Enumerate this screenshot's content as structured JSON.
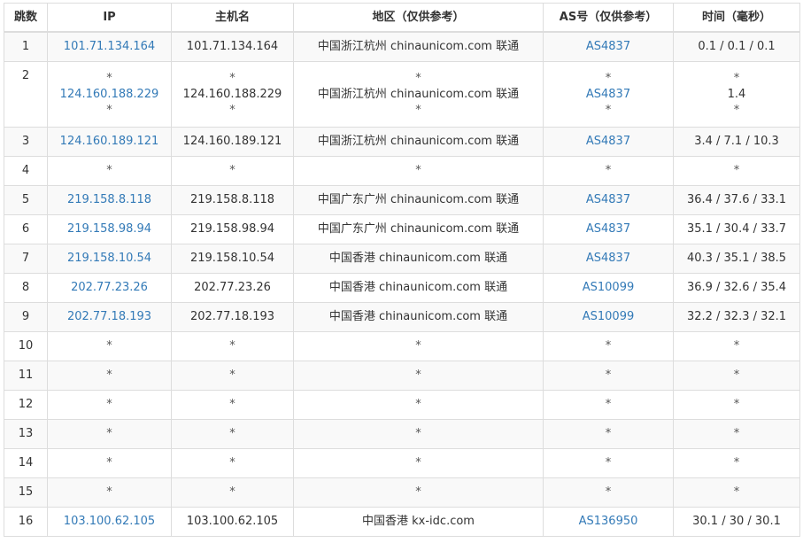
{
  "table": {
    "headers": {
      "hop": "跳数",
      "ip": "IP",
      "hostname": "主机名",
      "location": "地区（仅供参考）",
      "asn": "AS号（仅供参考）",
      "time": "时间（毫秒）"
    },
    "link_color": "#337ab7",
    "rows": [
      {
        "hop": "1",
        "ip": [
          "101.71.134.164"
        ],
        "hostname": [
          "101.71.134.164"
        ],
        "location": [
          "中国浙江杭州 chinaunicom.com 联通"
        ],
        "asn": [
          "AS4837"
        ],
        "time": [
          "0.1 / 0.1 / 0.1"
        ]
      },
      {
        "hop": "2",
        "ip": [
          "*",
          "124.160.188.229",
          "*"
        ],
        "hostname": [
          "*",
          "124.160.188.229",
          "*"
        ],
        "location": [
          "*",
          "中国浙江杭州 chinaunicom.com 联通",
          "*"
        ],
        "asn": [
          "*",
          "AS4837",
          "*"
        ],
        "time": [
          "*",
          "1.4",
          "*"
        ]
      },
      {
        "hop": "3",
        "ip": [
          "124.160.189.121"
        ],
        "hostname": [
          "124.160.189.121"
        ],
        "location": [
          "中国浙江杭州 chinaunicom.com 联通"
        ],
        "asn": [
          "AS4837"
        ],
        "time": [
          "3.4 / 7.1 / 10.3"
        ]
      },
      {
        "hop": "4",
        "ip": [
          "*"
        ],
        "hostname": [
          "*"
        ],
        "location": [
          "*"
        ],
        "asn": [
          "*"
        ],
        "time": [
          "*"
        ]
      },
      {
        "hop": "5",
        "ip": [
          "219.158.8.118"
        ],
        "hostname": [
          "219.158.8.118"
        ],
        "location": [
          "中国广东广州 chinaunicom.com 联通"
        ],
        "asn": [
          "AS4837"
        ],
        "time": [
          "36.4 / 37.6 / 33.1"
        ]
      },
      {
        "hop": "6",
        "ip": [
          "219.158.98.94"
        ],
        "hostname": [
          "219.158.98.94"
        ],
        "location": [
          "中国广东广州 chinaunicom.com 联通"
        ],
        "asn": [
          "AS4837"
        ],
        "time": [
          "35.1 / 30.4 / 33.7"
        ]
      },
      {
        "hop": "7",
        "ip": [
          "219.158.10.54"
        ],
        "hostname": [
          "219.158.10.54"
        ],
        "location": [
          "中国香港 chinaunicom.com 联通"
        ],
        "asn": [
          "AS4837"
        ],
        "time": [
          "40.3 / 35.1 / 38.5"
        ]
      },
      {
        "hop": "8",
        "ip": [
          "202.77.23.26"
        ],
        "hostname": [
          "202.77.23.26"
        ],
        "location": [
          "中国香港 chinaunicom.com 联通"
        ],
        "asn": [
          "AS10099"
        ],
        "time": [
          "36.9 / 32.6 / 35.4"
        ]
      },
      {
        "hop": "9",
        "ip": [
          "202.77.18.193"
        ],
        "hostname": [
          "202.77.18.193"
        ],
        "location": [
          "中国香港 chinaunicom.com 联通"
        ],
        "asn": [
          "AS10099"
        ],
        "time": [
          "32.2 / 32.3 / 32.1"
        ]
      },
      {
        "hop": "10",
        "ip": [
          "*"
        ],
        "hostname": [
          "*"
        ],
        "location": [
          "*"
        ],
        "asn": [
          "*"
        ],
        "time": [
          "*"
        ]
      },
      {
        "hop": "11",
        "ip": [
          "*"
        ],
        "hostname": [
          "*"
        ],
        "location": [
          "*"
        ],
        "asn": [
          "*"
        ],
        "time": [
          "*"
        ]
      },
      {
        "hop": "12",
        "ip": [
          "*"
        ],
        "hostname": [
          "*"
        ],
        "location": [
          "*"
        ],
        "asn": [
          "*"
        ],
        "time": [
          "*"
        ]
      },
      {
        "hop": "13",
        "ip": [
          "*"
        ],
        "hostname": [
          "*"
        ],
        "location": [
          "*"
        ],
        "asn": [
          "*"
        ],
        "time": [
          "*"
        ]
      },
      {
        "hop": "14",
        "ip": [
          "*"
        ],
        "hostname": [
          "*"
        ],
        "location": [
          "*"
        ],
        "asn": [
          "*"
        ],
        "time": [
          "*"
        ]
      },
      {
        "hop": "15",
        "ip": [
          "*"
        ],
        "hostname": [
          "*"
        ],
        "location": [
          "*"
        ],
        "asn": [
          "*"
        ],
        "time": [
          "*"
        ]
      },
      {
        "hop": "16",
        "ip": [
          "103.100.62.105"
        ],
        "hostname": [
          "103.100.62.105"
        ],
        "location": [
          "中国香港 kx-idc.com"
        ],
        "asn": [
          "AS136950"
        ],
        "time": [
          "30.1 / 30 / 30.1"
        ]
      }
    ]
  }
}
